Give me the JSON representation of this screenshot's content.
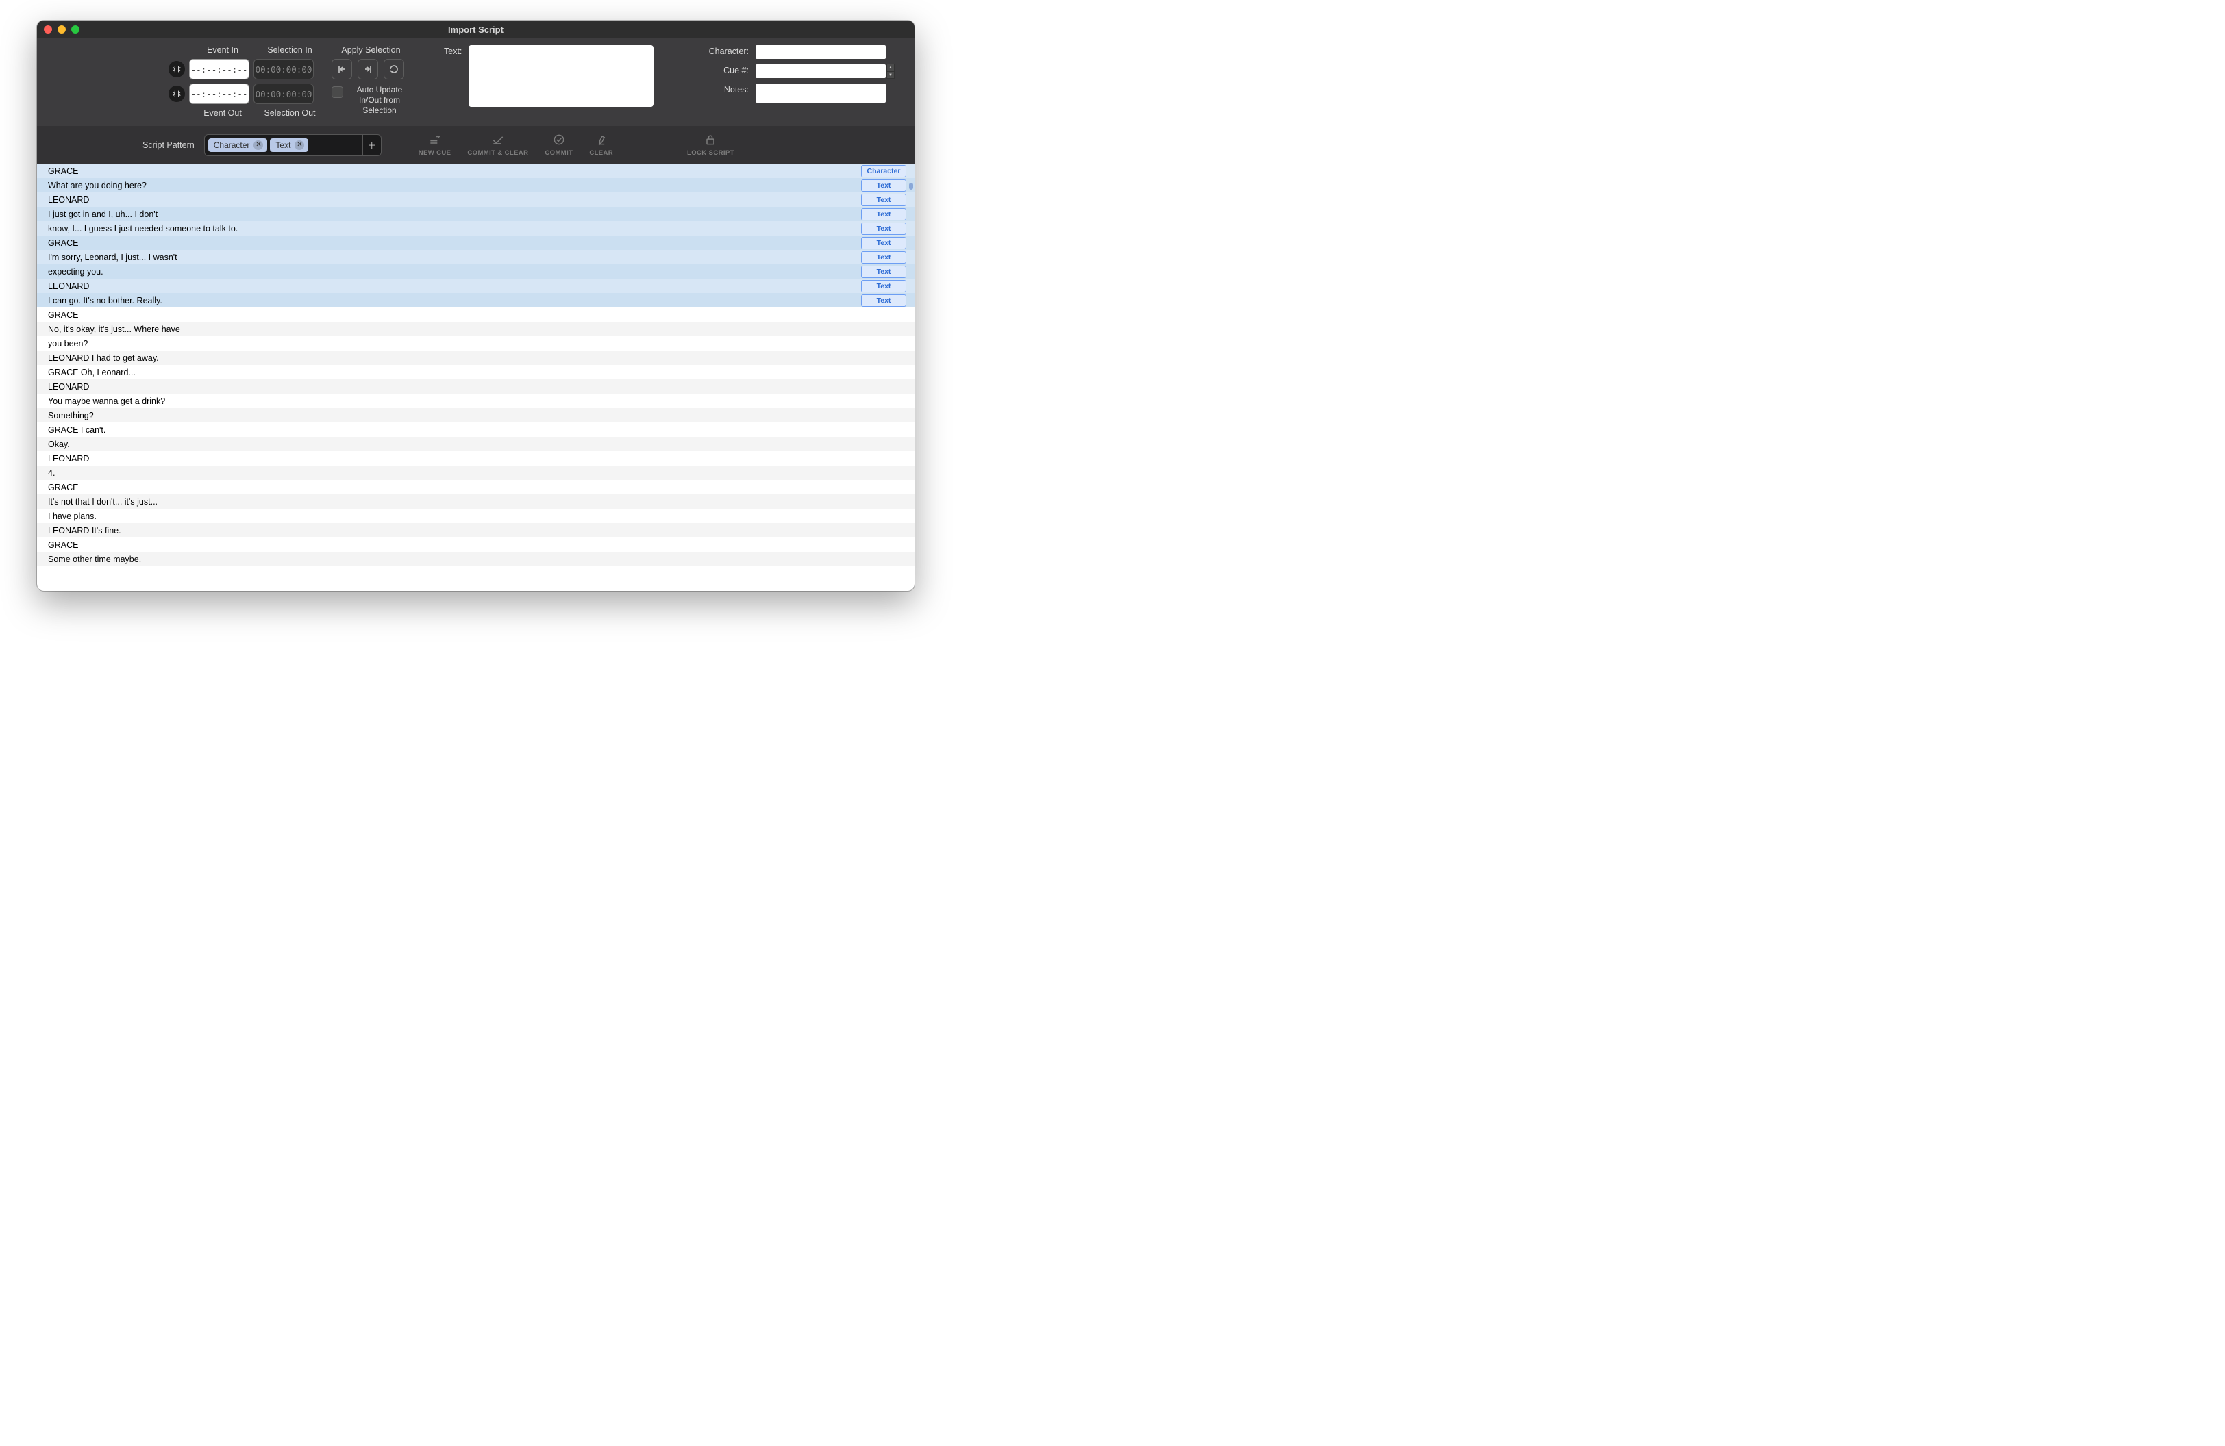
{
  "title": "Import Script",
  "tc": {
    "event_in_label": "Event In",
    "event_out_label": "Event Out",
    "selection_in_label": "Selection In",
    "selection_out_label": "Selection Out",
    "event_in_value": "--:--:--:--",
    "event_out_value": "--:--:--:--",
    "selection_in_value": "00:00:00:00",
    "selection_out_value": "00:00:00:00"
  },
  "apply": {
    "title": "Apply Selection",
    "auto_label": "Auto Update In/Out from Selection"
  },
  "left_fields": {
    "text_label": "Text:"
  },
  "right_fields": {
    "character_label": "Character:",
    "cue_label": "Cue #:",
    "notes_label": "Notes:"
  },
  "pattern": {
    "label": "Script Pattern",
    "tags": [
      "Character",
      "Text"
    ]
  },
  "actions": {
    "new_cue": "NEW CUE",
    "commit_clear": "COMMIT & CLEAR",
    "commit": "COMMIT",
    "clear": "CLEAR",
    "lock": "LOCK SCRIPT"
  },
  "script_rows": [
    {
      "text": "GRACE",
      "selected": true,
      "badge": "Character"
    },
    {
      "text": "What are you doing here?",
      "selected": true,
      "badge": "Text"
    },
    {
      "text": "LEONARD",
      "selected": true,
      "badge": "Text"
    },
    {
      "text": "I just got in and I, uh... I don't",
      "selected": true,
      "badge": "Text"
    },
    {
      "text": "know, I... I guess I just needed someone to talk to.",
      "selected": true,
      "badge": "Text"
    },
    {
      "text": "GRACE",
      "selected": true,
      "badge": "Text"
    },
    {
      "text": "I'm sorry, Leonard, I just... I wasn't",
      "selected": true,
      "badge": "Text"
    },
    {
      "text": "expecting you.",
      "selected": true,
      "badge": "Text"
    },
    {
      "text": "LEONARD",
      "selected": true,
      "badge": "Text"
    },
    {
      "text": "I can go. It's no bother. Really.",
      "selected": true,
      "badge": "Text"
    },
    {
      "text": "GRACE",
      "selected": false
    },
    {
      "text": "No, it's okay, it's just... Where have",
      "selected": false
    },
    {
      "text": "you been?",
      "selected": false
    },
    {
      "text": "LEONARD I had to get away.",
      "selected": false
    },
    {
      "text": "GRACE Oh, Leonard...",
      "selected": false
    },
    {
      "text": "LEONARD",
      "selected": false
    },
    {
      "text": "You maybe wanna get a drink?",
      "selected": false
    },
    {
      "text": "Something?",
      "selected": false
    },
    {
      "text": "GRACE I can't.",
      "selected": false
    },
    {
      "text": "Okay.",
      "selected": false
    },
    {
      "text": "LEONARD",
      "selected": false
    },
    {
      "text": "4.",
      "selected": false
    },
    {
      "text": "GRACE",
      "selected": false
    },
    {
      "text": "It's not that I don't... it's just...",
      "selected": false
    },
    {
      "text": "I have plans.",
      "selected": false
    },
    {
      "text": "LEONARD It's fine.",
      "selected": false
    },
    {
      "text": "GRACE",
      "selected": false
    },
    {
      "text": "Some other time maybe.",
      "selected": false
    }
  ]
}
